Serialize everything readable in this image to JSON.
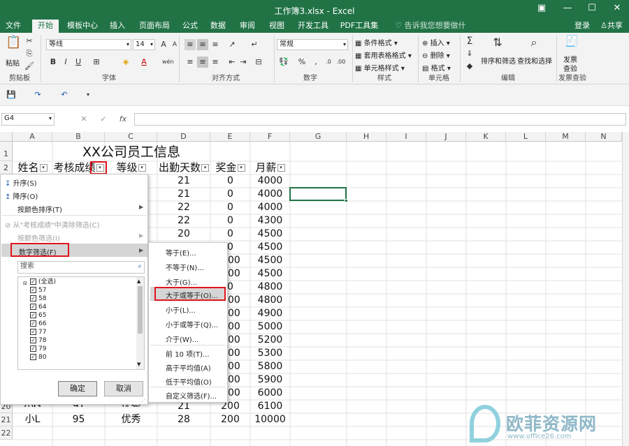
{
  "window": {
    "title": "工作簿3.xlsx - Excel",
    "controls": [
      "▣",
      "—",
      "☐",
      "✕"
    ]
  },
  "tabs": [
    "文件",
    "开始",
    "模板中心",
    "插入",
    "页面布局",
    "公式",
    "数据",
    "审阅",
    "视图",
    "开发工具",
    "PDF工具集"
  ],
  "tell_me": "告诉我您想要做什么...",
  "login": "登录",
  "share": "共享",
  "ribbon": {
    "clipboard": {
      "paste": "粘贴",
      "label": "剪贴板"
    },
    "font": {
      "name": "等线",
      "size": "14",
      "label": "字体",
      "bold": "B",
      "italic": "I",
      "underline": "U"
    },
    "align": {
      "label": "对齐方式"
    },
    "number": {
      "format": "常规",
      "label": "数字",
      "percent": "%",
      "comma": ","
    },
    "styles": {
      "conditional": "条件格式",
      "table": "套用表格格式",
      "cell": "单元格样式",
      "label": "样式"
    },
    "cells": {
      "insert": "插入",
      "delete": "删除",
      "format": "格式",
      "label": "单元格"
    },
    "editing": {
      "sort": "排序和筛选",
      "find": "查找和选择",
      "label": "编辑"
    },
    "invoice": {
      "check": "发票",
      "check2": "查验",
      "label": "发票查验"
    }
  },
  "formula": {
    "namebox": "G4",
    "fx": "fx",
    "cancel": "✕",
    "enter": "✓",
    "value": ""
  },
  "columns": [
    "A",
    "B",
    "C",
    "D",
    "E",
    "F",
    "G",
    "H",
    "I",
    "J",
    "K",
    "L",
    "M",
    "N"
  ],
  "sheet": {
    "title": "XX公司员工信息",
    "headers": [
      "姓名",
      "考核成绩",
      "等级",
      "出勤天数",
      "奖金",
      "月薪"
    ],
    "visible_d": [
      "21",
      "21",
      "22",
      "22",
      "20"
    ],
    "visible_e": [
      "0",
      "0",
      "0",
      "0",
      "0",
      "0",
      "00",
      "00",
      "0",
      "00",
      "00",
      "00",
      "00",
      "00",
      "00",
      "00",
      "00"
    ],
    "visible_f": [
      "4000",
      "4000",
      "4000",
      "4300",
      "4500",
      "4500",
      "4500",
      "4500",
      "4800",
      "4800",
      "4900",
      "5000",
      "5200",
      "5300",
      "5800",
      "5900",
      "6000"
    ],
    "row20": [
      "小G",
      "91",
      "优秀",
      "21",
      "200",
      "6100"
    ],
    "row21": [
      "小L",
      "95",
      "优秀",
      "28",
      "200",
      "10000"
    ]
  },
  "filter_menu": {
    "sort_asc": "升序(S)",
    "sort_desc": "降序(O)",
    "sort_color": "按颜色排序(T)",
    "clear": "从\"考核成绩\"中清除筛选(C)",
    "filter_color": "按颜色筛选(I)",
    "number_filter": "数字筛选(F)",
    "search": "搜索",
    "checks": [
      "(全选)",
      "57",
      "58",
      "64",
      "65",
      "66",
      "77",
      "78",
      "79",
      "80"
    ],
    "ok": "确定",
    "cancel": "取消"
  },
  "submenu": [
    "等于(E)...",
    "不等于(N)...",
    "大于(G)...",
    "大于或等于(O)...",
    "小于(L)...",
    "小于或等于(Q)...",
    "介于(W)...",
    "前 10 项(T)...",
    "高于平均值(A)",
    "低于平均值(O)",
    "自定义筛选(F)..."
  ],
  "watermark": {
    "text": "欧菲资源网",
    "url": "www.office26.com"
  },
  "colors": {
    "accent": "#217346",
    "highlight": "#e0141e"
  }
}
